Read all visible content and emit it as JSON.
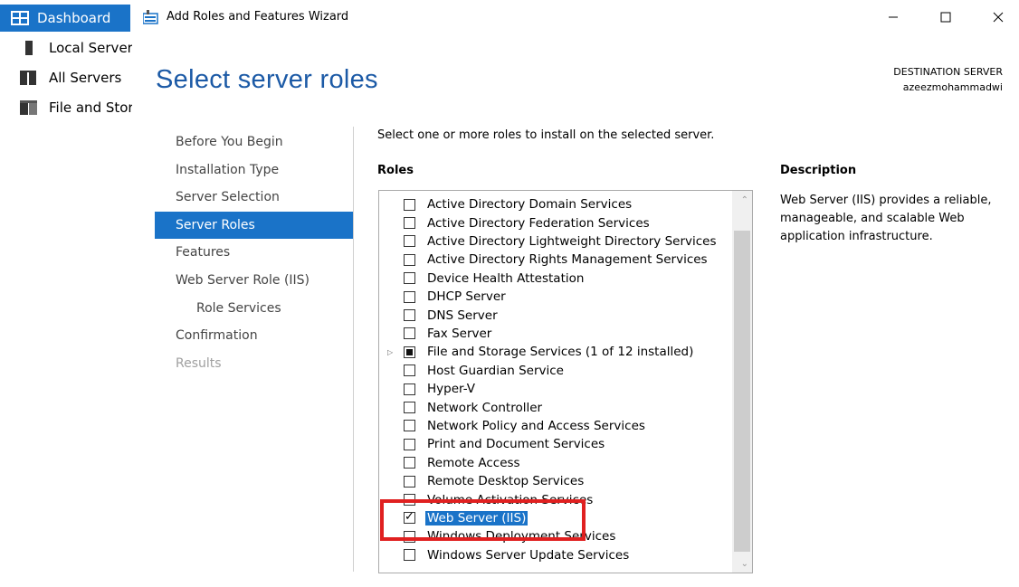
{
  "server_manager": {
    "sidebar": [
      {
        "label": "Dashboard",
        "icon": "dashboard-icon",
        "active": true
      },
      {
        "label": "Local Server",
        "icon": "local-server-icon"
      },
      {
        "label": "All Servers",
        "icon": "all-servers-icon"
      },
      {
        "label": "File and Storage Services",
        "icon": "file-storage-icon"
      }
    ]
  },
  "wizard": {
    "title": "Add Roles and Features Wizard",
    "page_heading": "Select server roles",
    "destination_label": "DESTINATION SERVER",
    "destination_name": "azeezmohammadwi",
    "nav": [
      {
        "label": "Before You Begin"
      },
      {
        "label": "Installation Type"
      },
      {
        "label": "Server Selection"
      },
      {
        "label": "Server Roles",
        "active": true
      },
      {
        "label": "Features"
      },
      {
        "label": "Web Server Role (IIS)"
      },
      {
        "label": "Role Services",
        "indent": true
      },
      {
        "label": "Confirmation"
      },
      {
        "label": "Results",
        "disabled": true
      }
    ],
    "instruction": "Select one or more roles to install on the selected server.",
    "roles_header": "Roles",
    "description_header": "Description",
    "description_text": "Web Server (IIS) provides a reliable, manageable, and scalable Web application infrastructure.",
    "roles": [
      {
        "label": "Active Directory Domain Services",
        "state": "unchecked"
      },
      {
        "label": "Active Directory Federation Services",
        "state": "unchecked"
      },
      {
        "label": "Active Directory Lightweight Directory Services",
        "state": "unchecked"
      },
      {
        "label": "Active Directory Rights Management Services",
        "state": "unchecked"
      },
      {
        "label": "Device Health Attestation",
        "state": "unchecked"
      },
      {
        "label": "DHCP Server",
        "state": "unchecked"
      },
      {
        "label": "DNS Server",
        "state": "unchecked"
      },
      {
        "label": "Fax Server",
        "state": "unchecked"
      },
      {
        "label": "File and Storage Services (1 of 12 installed)",
        "state": "partial",
        "expandable": true
      },
      {
        "label": "Host Guardian Service",
        "state": "unchecked"
      },
      {
        "label": "Hyper-V",
        "state": "unchecked"
      },
      {
        "label": "Network Controller",
        "state": "unchecked"
      },
      {
        "label": "Network Policy and Access Services",
        "state": "unchecked"
      },
      {
        "label": "Print and Document Services",
        "state": "unchecked"
      },
      {
        "label": "Remote Access",
        "state": "unchecked"
      },
      {
        "label": "Remote Desktop Services",
        "state": "unchecked"
      },
      {
        "label": "Volume Activation Services",
        "state": "unchecked"
      },
      {
        "label": "Web Server (IIS)",
        "state": "checked",
        "selected": true
      },
      {
        "label": "Windows Deployment Services",
        "state": "unchecked"
      },
      {
        "label": "Windows Server Update Services",
        "state": "unchecked"
      }
    ],
    "colors": {
      "accent": "#1a73c8",
      "heading": "#1c5aa6",
      "highlight": "#e02020"
    }
  }
}
